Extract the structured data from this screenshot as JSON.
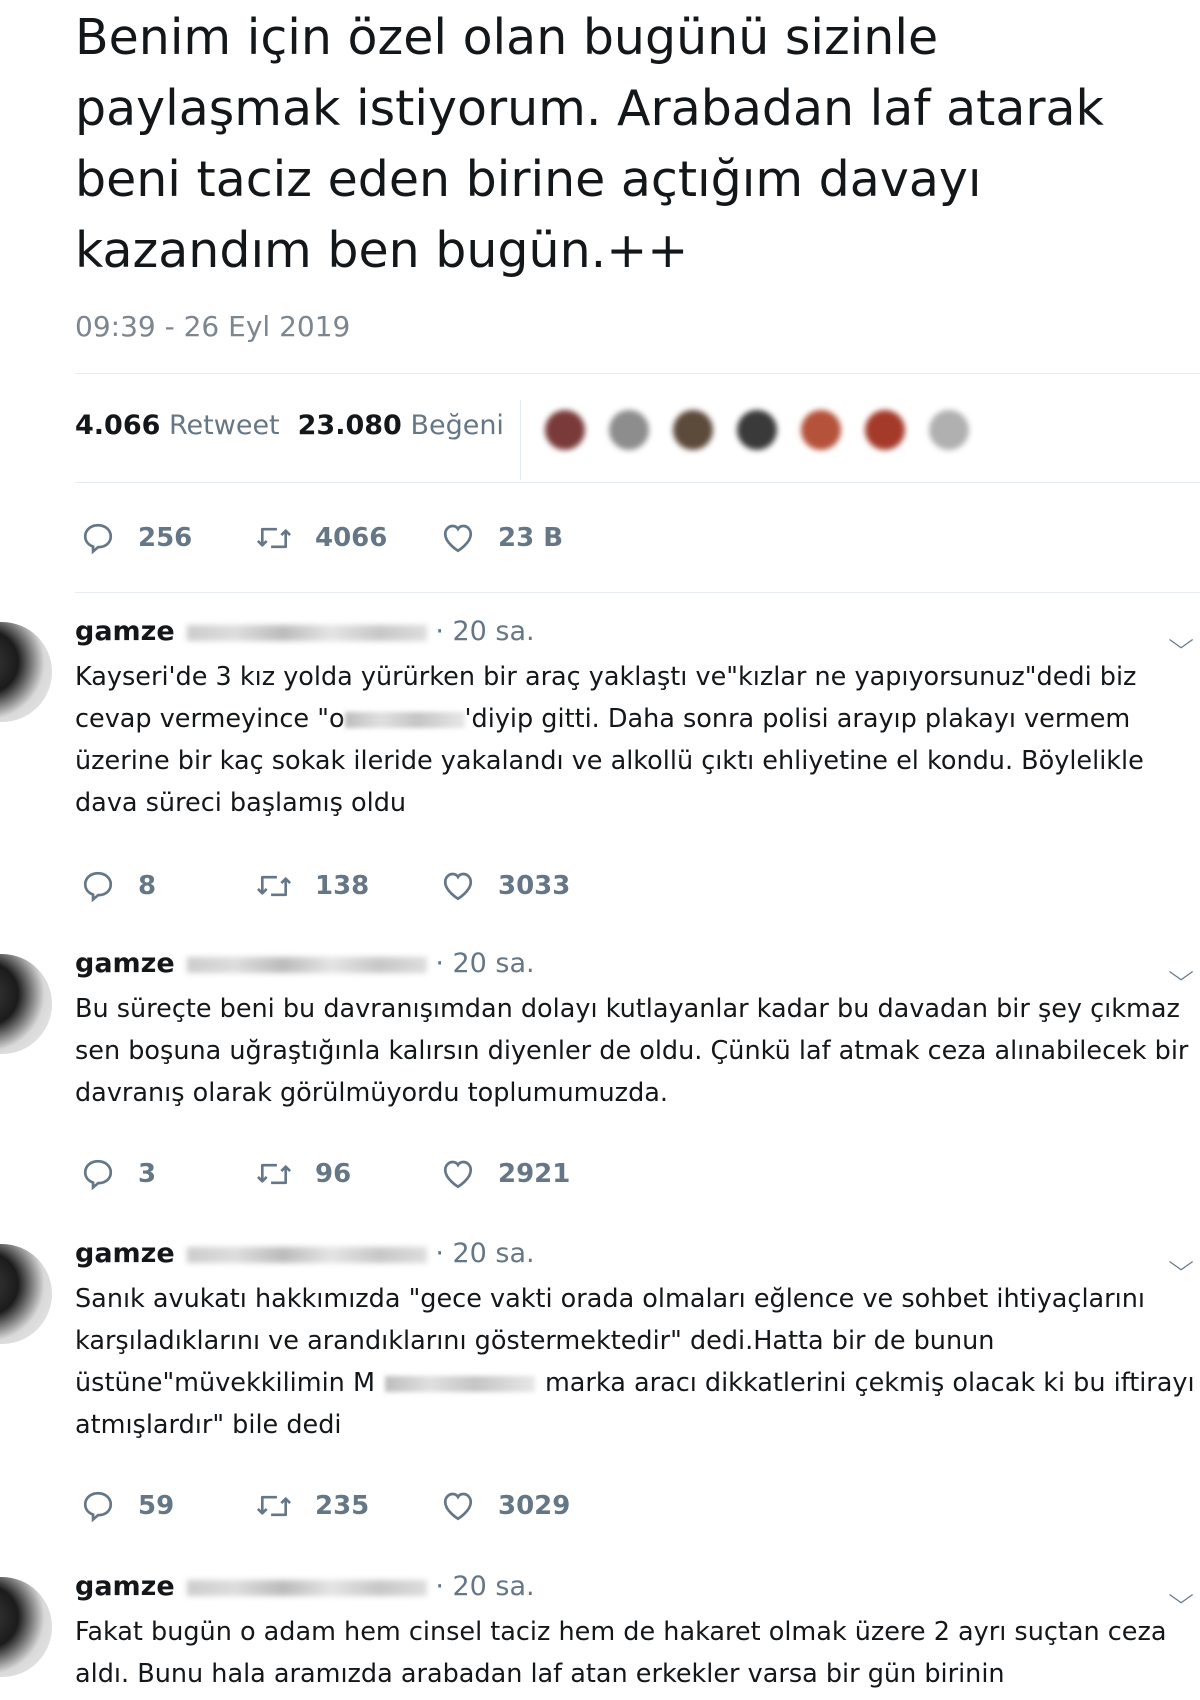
{
  "tweet": {
    "text": "Benim için özel olan bugünü sizinle paylaşmak istiyorum. Arabadan laf atarak beni taciz eden birine açtığım davayı kazandım ben bugün.++",
    "timestamp": "09:39 - 26 Eyl 2019",
    "retweet_count": "4.066",
    "retweet_label": "Retweet",
    "like_count": "23.080",
    "like_label": "Beğeni",
    "actions": {
      "replies": "256",
      "retweets": "4066",
      "likes": "23 B"
    }
  },
  "replies": [
    {
      "name": "gamze",
      "time": "· 20 sa.",
      "text_a": "Kayseri'de 3 kız yolda yürürken bir araç yaklaştı ve\"kızlar ne yapıyorsunuz\"dedi biz cevap vermeyince \"o",
      "text_b": "'diyip gitti. Daha sonra polisi arayıp plakayı vermem üzerine bir kaç sokak ileride yakalandı ve alkollü çıktı ehliyetine el kondu. Böylelikle dava süreci başlamış oldu",
      "replies": "8",
      "retweets": "138",
      "likes": "3033"
    },
    {
      "name": "gamze",
      "time": "· 20 sa.",
      "text": "Bu süreçte beni bu davranışımdan dolayı kutlayanlar kadar bu davadan bir şey çıkmaz sen boşuna uğraştığınla kalırsın diyenler de oldu. Çünkü laf atmak ceza alınabilecek bir davranış olarak görülmüyordu toplumumuzda.",
      "replies": "3",
      "retweets": "96",
      "likes": "2921"
    },
    {
      "name": "gamze",
      "time": "· 20 sa.",
      "text_a": "Sanık avukatı hakkımızda \"gece vakti orada olmaları eğlence ve sohbet ihtiyaçlarını karşıladıklarını ve arandıklarını göstermektedir\" dedi.Hatta bir de bunun üstüne\"müvekkilimin M",
      "text_b": "marka aracı dikkatlerini çekmiş olacak ki bu iftirayı atmışlardır\" bile dedi",
      "replies": "59",
      "retweets": "235",
      "likes": "3029"
    },
    {
      "name": "gamze",
      "time": "· 20 sa.",
      "text": "Fakat bugün o adam hem cinsel taciz hem de hakaret olmak üzere 2 ayrı suçtan ceza aldı. Bunu hala aramızda arabadan laf atan erkekler varsa bir gün birinin"
    }
  ],
  "icons": {
    "reply": "reply-icon",
    "retweet": "retweet-icon",
    "like": "heart-icon",
    "more": "chevron-down-icon"
  },
  "colors": {
    "text": "#14171a",
    "secondary": "#657786",
    "divider": "#e6ecf0"
  }
}
